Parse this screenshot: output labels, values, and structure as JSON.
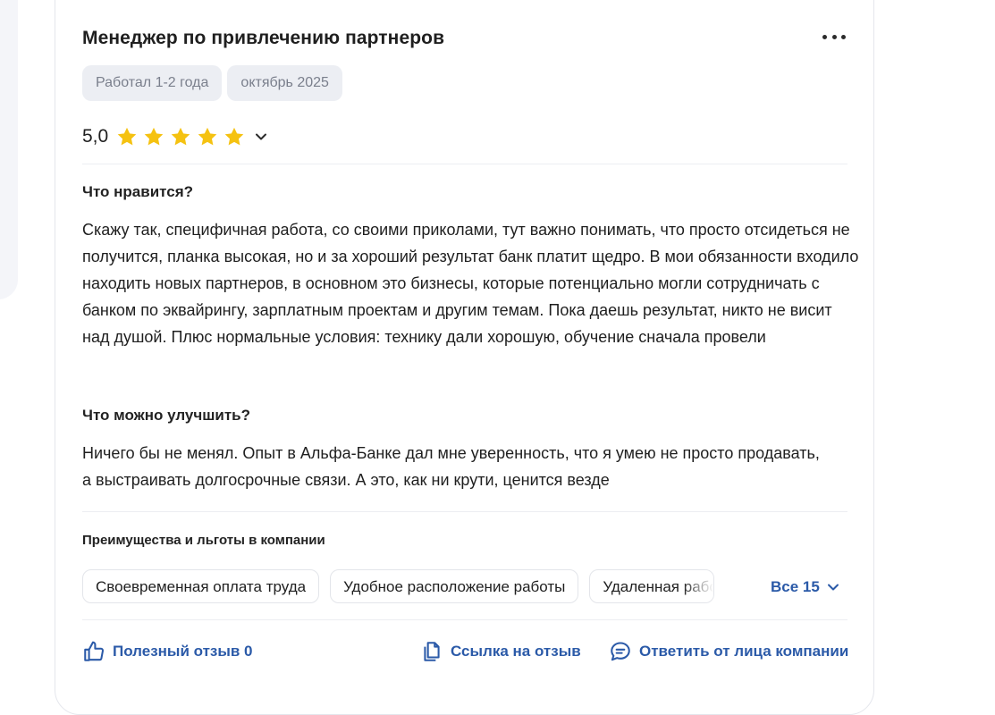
{
  "review": {
    "title": "Менеджер по привлечению партнеров",
    "tags": [
      "Работал 1-2 года",
      "октябрь 2025"
    ],
    "rating": {
      "value": "5,0",
      "stars": 5,
      "star_color": "#f5c211"
    },
    "likes": {
      "title": "Что нравится?",
      "text": "Скажу так, специфичная работа, со своими приколами, тут важно понимать, что просто отсидеться не получится, планка высокая, но и за хороший результат банк платит щедро. В мои обязанности входило находить новых партнеров, в основном это бизнесы, которые потенциально могли сотрудничать с банком по эквайрингу, зарплатным проектам и другим темам. Пока даешь результат, никто не висит над душой. Плюс нормальные условия: технику дали хорошую, обучение сначала провели"
    },
    "improve": {
      "title": "Что можно улучшить?",
      "text": "Ничего бы не менял. Опыт в Альфа-Банке дал мне уверенность, что я умею не просто продавать, а выстраивать долгосрочные связи. А это, как ни крути, ценится везде"
    },
    "benefits": {
      "title": "Преимущества и льготы в компании",
      "chips": [
        "Своевременная оплата труда",
        "Удобное расположение работы",
        "Удаленная работа"
      ],
      "all_label": "Все 15"
    },
    "actions": {
      "helpful": "Полезный отзыв 0",
      "link": "Ссылка на отзыв",
      "reply": "Ответить от лица компании"
    },
    "colors": {
      "link": "#2b5aa8",
      "tag_bg": "#eceef3"
    },
    "icons": [
      "more-icon",
      "star-icon",
      "chevron-down-icon",
      "thumbs-up-icon",
      "copy-icon",
      "comment-icon"
    ]
  }
}
